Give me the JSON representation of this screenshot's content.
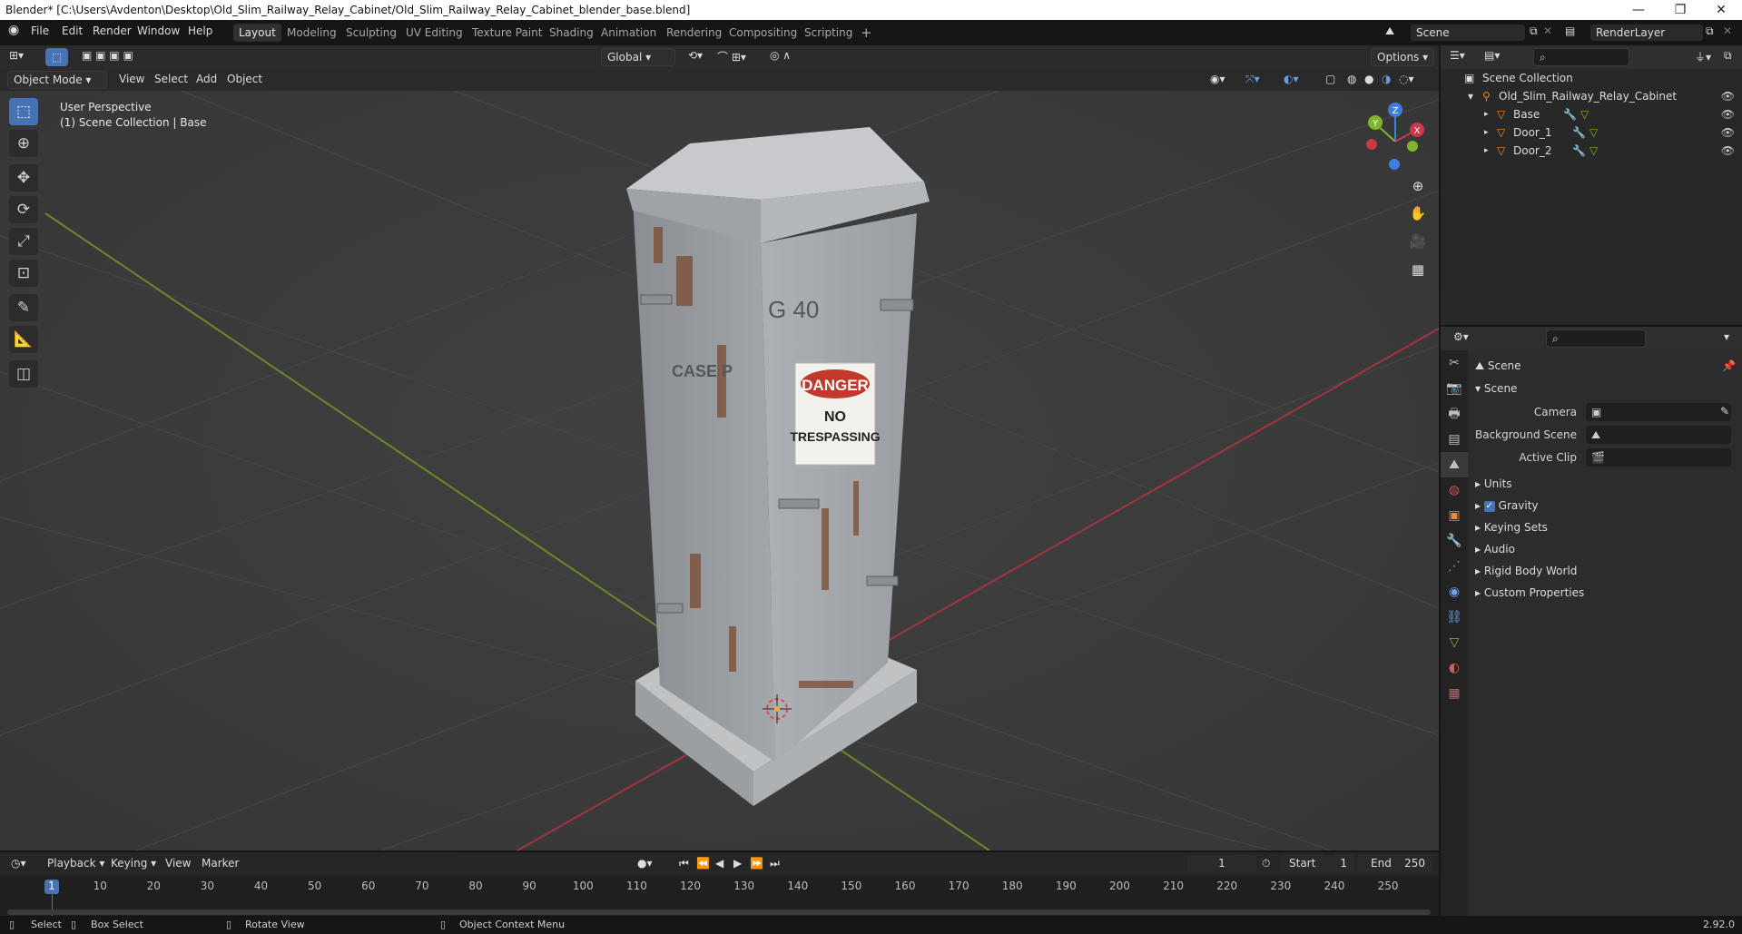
{
  "window": {
    "title": "Blender* [C:\\Users\\Avdenton\\Desktop\\Old_Slim_Railway_Relay_Cabinet/Old_Slim_Railway_Relay_Cabinet_blender_base.blend]",
    "minimize": "—",
    "maximize": "❐",
    "close": "✕"
  },
  "menubar": {
    "items": [
      "File",
      "Edit",
      "Render",
      "Window",
      "Help"
    ],
    "workspaces": [
      "Layout",
      "Modeling",
      "Sculpting",
      "UV Editing",
      "Texture Paint",
      "Shading",
      "Animation",
      "Rendering",
      "Compositing",
      "Scripting"
    ],
    "active_workspace": "Layout",
    "add_workspace": "+",
    "scene_name": "Scene",
    "render_layer": "RenderLayer"
  },
  "viewport": {
    "transform_orientation": "Global",
    "options_label": "Options",
    "mode": "Object Mode",
    "menus": [
      "View",
      "Select",
      "Add",
      "Object"
    ],
    "perspective_label": "User Perspective",
    "collection_label": "(1) Scene Collection | Base",
    "gizmo": {
      "z": "Z",
      "y": "Y",
      "x": "X"
    },
    "sign_top": "DANGER",
    "sign_line1": "NO",
    "sign_line2": "TRESPASSING",
    "cabinet_label": "G 40",
    "case_label": "CASE P"
  },
  "outliner": {
    "root": "Scene Collection",
    "collection": "Old_Slim_Railway_Relay_Cabinet",
    "objects": [
      "Base",
      "Door_1",
      "Door_2"
    ]
  },
  "properties": {
    "context_title": "Scene",
    "panel_title": "Scene",
    "camera_label": "Camera",
    "background_scene_label": "Background Scene",
    "active_clip_label": "Active Clip",
    "sections": [
      "Units",
      "Gravity",
      "Keying Sets",
      "Audio",
      "Rigid Body World",
      "Custom Properties"
    ],
    "gravity_checked": true
  },
  "timeline": {
    "menus": [
      "Playback",
      "Keying",
      "View",
      "Marker"
    ],
    "current_frame": "1",
    "start_label": "Start",
    "start_value": "1",
    "end_label": "End",
    "end_value": "250",
    "ticks": [
      "1",
      "10",
      "20",
      "30",
      "40",
      "50",
      "60",
      "70",
      "80",
      "90",
      "100",
      "110",
      "120",
      "130",
      "140",
      "150",
      "160",
      "170",
      "180",
      "190",
      "200",
      "210",
      "220",
      "230",
      "240",
      "250"
    ]
  },
  "statusbar": {
    "select": "Select",
    "box_select": "Box Select",
    "rotate_view": "Rotate View",
    "context_menu": "Object Context Menu",
    "version": "2.92.0"
  },
  "colors": {
    "accent": "#4772b3",
    "axis_x": "#c8394a",
    "axis_y": "#7fb52d",
    "axis_z": "#3d7ee0",
    "object_orange": "#e8893a"
  }
}
